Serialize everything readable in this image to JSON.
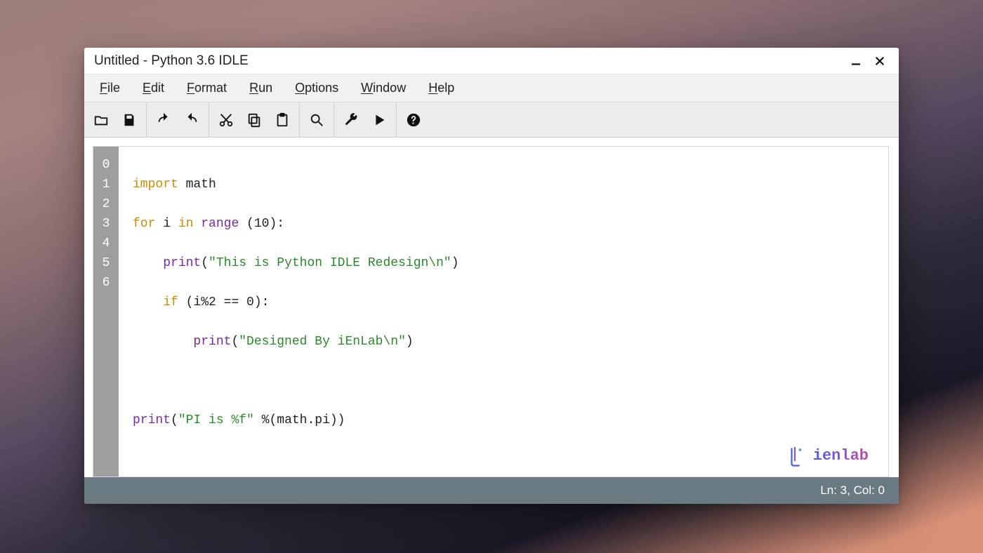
{
  "window": {
    "title": "Untitled - Python 3.6 IDLE"
  },
  "menubar": {
    "items": [
      {
        "accel": "F",
        "rest": "ile"
      },
      {
        "accel": "E",
        "rest": "dit"
      },
      {
        "accel": "F",
        "rest": "ormat"
      },
      {
        "accel": "R",
        "rest": "un"
      },
      {
        "accel": "O",
        "rest": "ptions"
      },
      {
        "accel": "W",
        "rest": "indow"
      },
      {
        "accel": "H",
        "rest": "elp"
      }
    ]
  },
  "toolbar": {
    "icons": {
      "open": "open-folder",
      "save": "save",
      "undo": "undo",
      "redo": "redo",
      "cut": "cut",
      "copy": "copy",
      "paste": "paste",
      "search": "search",
      "settings": "wrench",
      "run": "play",
      "help": "help"
    }
  },
  "editor": {
    "gutter": [
      "0",
      "1",
      "2",
      "3",
      "4",
      "5",
      "6"
    ],
    "code": {
      "l0": {
        "kw_import": "import",
        "t_rest": " math"
      },
      "l1": {
        "kw_for": "for",
        "t_i": " i ",
        "kw_in": "in",
        "t_sp": " ",
        "fn_range": "range",
        "t_args": " (10):"
      },
      "l2": {
        "indent": "    ",
        "fn_print": "print",
        "t_open": "(",
        "str": "\"This is Python IDLE Redesign\\n\"",
        "t_close": ")"
      },
      "l3": {
        "indent": "    ",
        "kw_if": "if",
        "t_cond": " (i%2 == 0):"
      },
      "l4": {
        "indent": "        ",
        "fn_print": "print",
        "t_open": "(",
        "str": "\"Designed By iEnLab\\n\"",
        "t_close": ")"
      },
      "l5": {
        "blank": ""
      },
      "l6": {
        "fn_print": "print",
        "t_open": "(",
        "str": "\"PI is %f\"",
        "t_pct": " %(math.pi))"
      }
    }
  },
  "logo": {
    "text": "ienlab"
  },
  "status": {
    "text": "Ln: 3, Col: 0"
  }
}
